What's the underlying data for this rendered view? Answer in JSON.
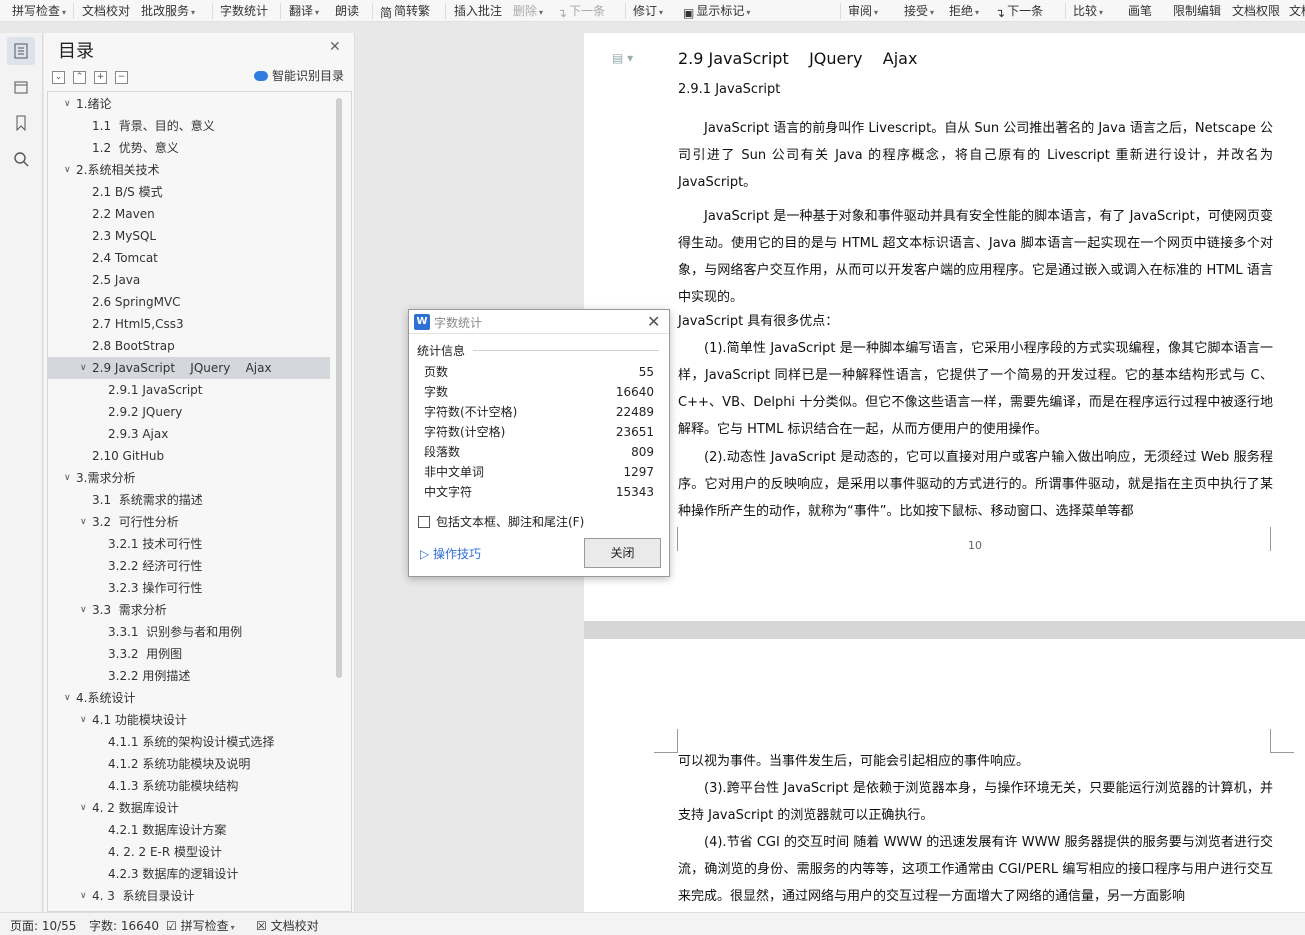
{
  "toolbar": {
    "items": [
      {
        "label": "拼写检查",
        "caret": true
      },
      {
        "label": "文档校对"
      },
      {
        "label": "批改服务",
        "caret": true
      },
      {
        "label": "字数统计"
      },
      {
        "label": "翻译",
        "caret": true
      },
      {
        "label": "朗读"
      },
      {
        "label": "简转繁"
      },
      {
        "label": "插入批注"
      },
      {
        "label": "删除",
        "caret": true,
        "disabled": true
      },
      {
        "label": "下一条",
        "disabled": true
      },
      {
        "label": "修订",
        "caret": true
      },
      {
        "label": "显示标记",
        "caret": true
      },
      {
        "label": "审阅",
        "caret": true
      },
      {
        "label": "接受",
        "caret": true
      },
      {
        "label": "拒绝",
        "caret": true
      },
      {
        "label": "下一条"
      },
      {
        "label": "比较",
        "caret": true
      },
      {
        "label": "画笔"
      },
      {
        "label": "限制编辑"
      },
      {
        "label": "文档权限"
      },
      {
        "label": "文档"
      }
    ]
  },
  "outline": {
    "title": "目录",
    "smart_label": "智能识别目录",
    "items": [
      {
        "label": "1.绪论",
        "level": 1,
        "expanded": true
      },
      {
        "label": "1.1  背景、目的、意义",
        "level": 2
      },
      {
        "label": "1.2  优势、意义",
        "level": 2
      },
      {
        "label": "2.系统相关技术",
        "level": 1,
        "expanded": true
      },
      {
        "label": "2.1 B/S 模式",
        "level": 2
      },
      {
        "label": "2.2 Maven",
        "level": 2
      },
      {
        "label": "2.3 MySQL",
        "level": 2
      },
      {
        "label": "2.4 Tomcat",
        "level": 2
      },
      {
        "label": "2.5 Java",
        "level": 2
      },
      {
        "label": "2.6 SpringMVC",
        "level": 2
      },
      {
        "label": "2.7 Html5,Css3",
        "level": 2
      },
      {
        "label": "2.8 BootStrap",
        "level": 2
      },
      {
        "label": "2.9 JavaScript    JQuery    Ajax",
        "level": 2,
        "expanded": true,
        "selected": true
      },
      {
        "label": "2.9.1 JavaScript",
        "level": 3
      },
      {
        "label": "2.9.2 JQuery",
        "level": 3
      },
      {
        "label": "2.9.3 Ajax",
        "level": 3
      },
      {
        "label": "2.10 GitHub",
        "level": 2
      },
      {
        "label": "3.需求分析",
        "level": 1,
        "expanded": true
      },
      {
        "label": "3.1  系统需求的描述",
        "level": 2
      },
      {
        "label": "3.2  可行性分析",
        "level": 2,
        "expanded": true
      },
      {
        "label": "3.2.1 技术可行性",
        "level": 3
      },
      {
        "label": "3.2.2 经济可行性",
        "level": 3
      },
      {
        "label": "3.2.3 操作可行性",
        "level": 3
      },
      {
        "label": "3.3  需求分析",
        "level": 2,
        "expanded": true
      },
      {
        "label": "3.3.1  识别参与者和用例",
        "level": 3
      },
      {
        "label": "3.3.2  用例图",
        "level": 3
      },
      {
        "label": "3.2.2 用例描述",
        "level": 3
      },
      {
        "label": "4.系统设计",
        "level": 1,
        "expanded": true
      },
      {
        "label": "4.1 功能模块设计",
        "level": 2,
        "expanded": true
      },
      {
        "label": "4.1.1 系统的架构设计模式选择",
        "level": 3
      },
      {
        "label": "4.1.2 系统功能模块及说明",
        "level": 3
      },
      {
        "label": "4.1.3 系统功能模块结构",
        "level": 3
      },
      {
        "label": "4. 2 数据库设计",
        "level": 2,
        "expanded": true
      },
      {
        "label": "4.2.1 数据库设计方案",
        "level": 3
      },
      {
        "label": "4. 2. 2 E-R 模型设计",
        "level": 3
      },
      {
        "label": "4.2.3 数据库的逻辑设计",
        "level": 3
      },
      {
        "label": "4. 3  系统目录设计",
        "level": 2,
        "expanded": true
      }
    ]
  },
  "document": {
    "heading1": "2.9 JavaScript    JQuery    Ajax",
    "heading2": "2.9.1 JavaScript",
    "page1_paragraphs": [
      "    JavaScript 语言的前身叫作 Livescript。自从 Sun 公司推出著名的 Java 语言之后，Netscape 公司引进了 Sun 公司有关 Java 的程序概念，将自己原有的 Livescript 重新进行设计，并改名为 JavaScript。",
      "JavaScript 是一种基于对象和事件驱动并具有安全性能的脚本语言，有了 JavaScript，可使网页变得生动。使用它的目的是与 HTML 超文本标识语言、Java 脚本语言一起实现在一个网页中链接多个对象，与网络客户交互作用，从而可以开发客户端的应用程序。它是通过嵌入或调入在标准的 HTML 语言中实现的。",
      " JavaScript 具有很多优点：",
      "(1).简单性    JavaScript 是一种脚本编写语言，它采用小程序段的方式实现编程，像其它脚本语言一样，JavaScript 同样已是一种解释性语言，它提供了一个简易的开发过程。它的基本结构形式与 C、C++、VB、Delphi 十分类似。但它不像这些语言一样，需要先编译，而是在程序运行过程中被逐行地解释。它与 HTML 标识结合在一起，从而方便用户的使用操作。",
      "(2).动态性    JavaScript 是动态的，它可以直接对用户或客户输入做出响应，无须经过 Web 服务程序。它对用户的反映响应，是采用以事件驱动的方式进行的。所谓事件驱动，就是指在主页中执行了某种操作所产生的动作，就称为“事件”。比如按下鼠标、移动窗口、选择菜单等都"
    ],
    "page_number": "10",
    "page2_paragraphs": [
      "可以视为事件。当事件发生后，可能会引起相应的事件响应。",
      "(3).跨平台性    JavaScript 是依赖于浏览器本身，与操作环境无关，只要能运行浏览器的计算机，并支持 JavaScript 的浏览器就可以正确执行。",
      "(4).节省 CGI 的交互时间    随着 WWW 的迅速发展有许 WWW 服务器提供的服务要与浏览者进行交流，确浏览的身份、需服务的内等等，这项工作通常由 CGI/PERL 编写相应的接口程序与用户进行交互来完成。很显然，通过网络与用户的交互过程一方面增大了网络的通信量，另一方面影响"
    ]
  },
  "dialog": {
    "title": "字数统计",
    "section": "统计信息",
    "rows": [
      {
        "label": "页数",
        "value": "55"
      },
      {
        "label": "字数",
        "value": "16640"
      },
      {
        "label": "字符数(不计空格)",
        "value": "22489"
      },
      {
        "label": "字符数(计空格)",
        "value": "23651"
      },
      {
        "label": "段落数",
        "value": "809"
      },
      {
        "label": "非中文单词",
        "value": "1297"
      },
      {
        "label": "中文字符",
        "value": "15343"
      }
    ],
    "checkbox_label": "包括文本框、脚注和尾注(F)",
    "tips_label": "操作技巧",
    "close_label": "关闭"
  },
  "status": {
    "page": "页面: 10/55",
    "words": "字数: 16640",
    "spell": "拼写检查",
    "proof": "文档校对"
  },
  "colors": {
    "accent": "#2f6fd6",
    "selection": "#d4d7dc"
  }
}
